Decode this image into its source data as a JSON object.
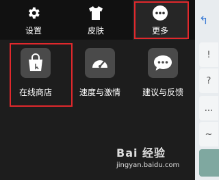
{
  "tabs": [
    {
      "label": "设置",
      "icon": "gear-icon"
    },
    {
      "label": "皮肤",
      "icon": "tshirt-icon"
    },
    {
      "label": "更多",
      "icon": "more-dots-icon"
    }
  ],
  "items": [
    {
      "label": "在线商店",
      "icon": "shopping-bag-icon"
    },
    {
      "label": "速度与激情",
      "icon": "speedometer-icon"
    },
    {
      "label": "建议与反馈",
      "icon": "chat-bubble-icon"
    }
  ],
  "keyboard_keys": [
    "!",
    "?",
    "...",
    "~"
  ],
  "watermark": {
    "main": "Bai 经验",
    "url": "jingyan.baidu.com"
  },
  "colors": {
    "highlight": "#e0282c",
    "background": "#1a1a1a",
    "tile": "#4a4a4a"
  }
}
